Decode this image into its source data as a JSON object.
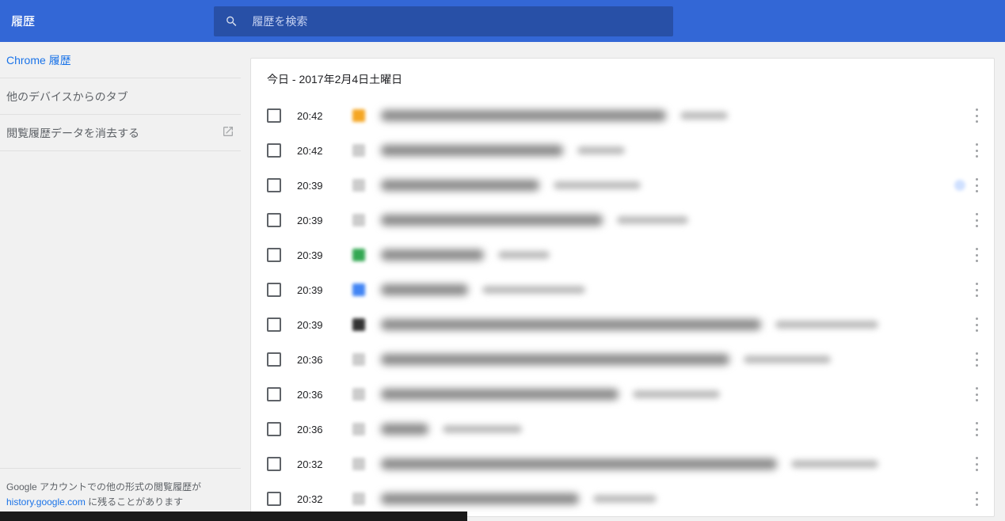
{
  "header": {
    "title": "履歴"
  },
  "search": {
    "placeholder": "履歴を検索"
  },
  "sidebar": {
    "items": [
      {
        "label": "Chrome 履歴",
        "active": true,
        "external": false
      },
      {
        "label": "他のデバイスからのタブ",
        "active": false,
        "external": false
      },
      {
        "label": "閲覧履歴データを消去する",
        "active": false,
        "external": true
      }
    ],
    "footer_pre": "Google アカウントでの他の形式の閲覧履歴が ",
    "footer_link": "history.google.com",
    "footer_post": " に残ることがあります"
  },
  "main": {
    "date_heading": "今日 - 2017年2月4日土曜日",
    "entries": [
      {
        "time": "20:42",
        "favicon_color": "#f5a623",
        "title_w": 360,
        "domain_w": 60,
        "bookmark": false
      },
      {
        "time": "20:42",
        "favicon_color": "#cccccc",
        "title_w": 230,
        "domain_w": 60,
        "bookmark": false
      },
      {
        "time": "20:39",
        "favicon_color": "#cccccc",
        "title_w": 200,
        "domain_w": 110,
        "bookmark": true
      },
      {
        "time": "20:39",
        "favicon_color": "#cccccc",
        "title_w": 280,
        "domain_w": 90,
        "bookmark": false
      },
      {
        "time": "20:39",
        "favicon_color": "#34a853",
        "title_w": 130,
        "domain_w": 65,
        "bookmark": false
      },
      {
        "time": "20:39",
        "favicon_color": "#4285f4",
        "title_w": 110,
        "domain_w": 130,
        "bookmark": false
      },
      {
        "time": "20:39",
        "favicon_color": "#333333",
        "title_w": 480,
        "domain_w": 130,
        "bookmark": false
      },
      {
        "time": "20:36",
        "favicon_color": "#cccccc",
        "title_w": 440,
        "domain_w": 110,
        "bookmark": false
      },
      {
        "time": "20:36",
        "favicon_color": "#cccccc",
        "title_w": 300,
        "domain_w": 110,
        "bookmark": false
      },
      {
        "time": "20:36",
        "favicon_color": "#cccccc",
        "title_w": 60,
        "domain_w": 100,
        "bookmark": false
      },
      {
        "time": "20:32",
        "favicon_color": "#cccccc",
        "title_w": 500,
        "domain_w": 110,
        "bookmark": false
      },
      {
        "time": "20:32",
        "favicon_color": "#cccccc",
        "title_w": 250,
        "domain_w": 80,
        "bookmark": false
      }
    ]
  }
}
